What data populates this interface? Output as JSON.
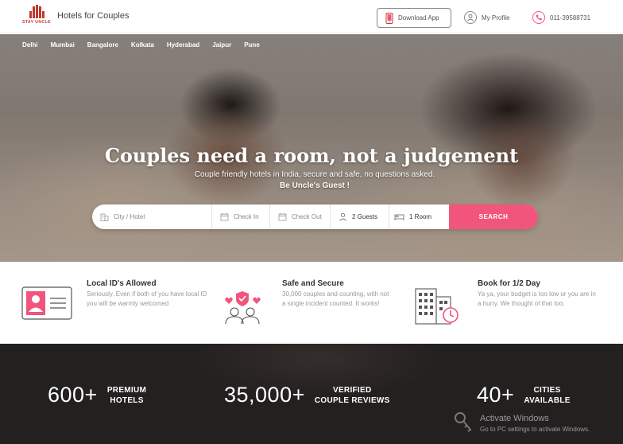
{
  "header": {
    "logo_text": "STAY UNCLE",
    "tagline": "Hotels for Couples",
    "download_label": "Download App",
    "profile_label": "My Profile",
    "phone_label": "011-39588731"
  },
  "cities": [
    "Delhi",
    "Mumbai",
    "Bangalore",
    "Kolkata",
    "Hyderabad",
    "Jaipur",
    "Pune"
  ],
  "hero": {
    "title": "Couples need a room, not a judgement",
    "subtitle": "Couple friendly hotels in India, secure and safe, no questions asked.",
    "subtitle2": "Be Uncle's Guest !"
  },
  "search": {
    "city_placeholder": "City / Hotel",
    "checkin_placeholder": "Check In",
    "checkout_placeholder": "Check Out",
    "guests_value": "2 Guests",
    "rooms_value": "1 Room",
    "search_label": "SEARCH"
  },
  "features": [
    {
      "title": "Local ID's Allowed",
      "body": "Seriously. Even if both of you have local ID you will be warmly welcomed"
    },
    {
      "title": "Safe and Secure",
      "body": "30,000 couples and counting, with not a single incident counted. It works!"
    },
    {
      "title": "Book for 1/2 Day",
      "body": "Ya ya, your budget is too low or you are in a hurry. We thought of that too."
    }
  ],
  "stats": [
    {
      "number": "600+",
      "label_line1": "PREMIUM",
      "label_line2": "HOTELS"
    },
    {
      "number": "35,000+",
      "label_line1": "VERIFIED",
      "label_line2": "COUPLE REVIEWS"
    },
    {
      "number": "40+",
      "label_line1": "CITIES",
      "label_line2": "AVAILABLE"
    }
  ],
  "watermark": {
    "line1": "Activate Windows",
    "line2": "Go to PC settings to activate Windows."
  },
  "colors": {
    "accent": "#f2557b",
    "brand": "#c0392b",
    "stats_bg": "#232020"
  },
  "icons": [
    "phone-icon",
    "user-icon",
    "call-icon",
    "building-icon",
    "calendar-icon",
    "person-icon",
    "bed-icon",
    "id-card-icon",
    "couple-shield-icon",
    "hotel-clock-icon",
    "key-icon"
  ]
}
